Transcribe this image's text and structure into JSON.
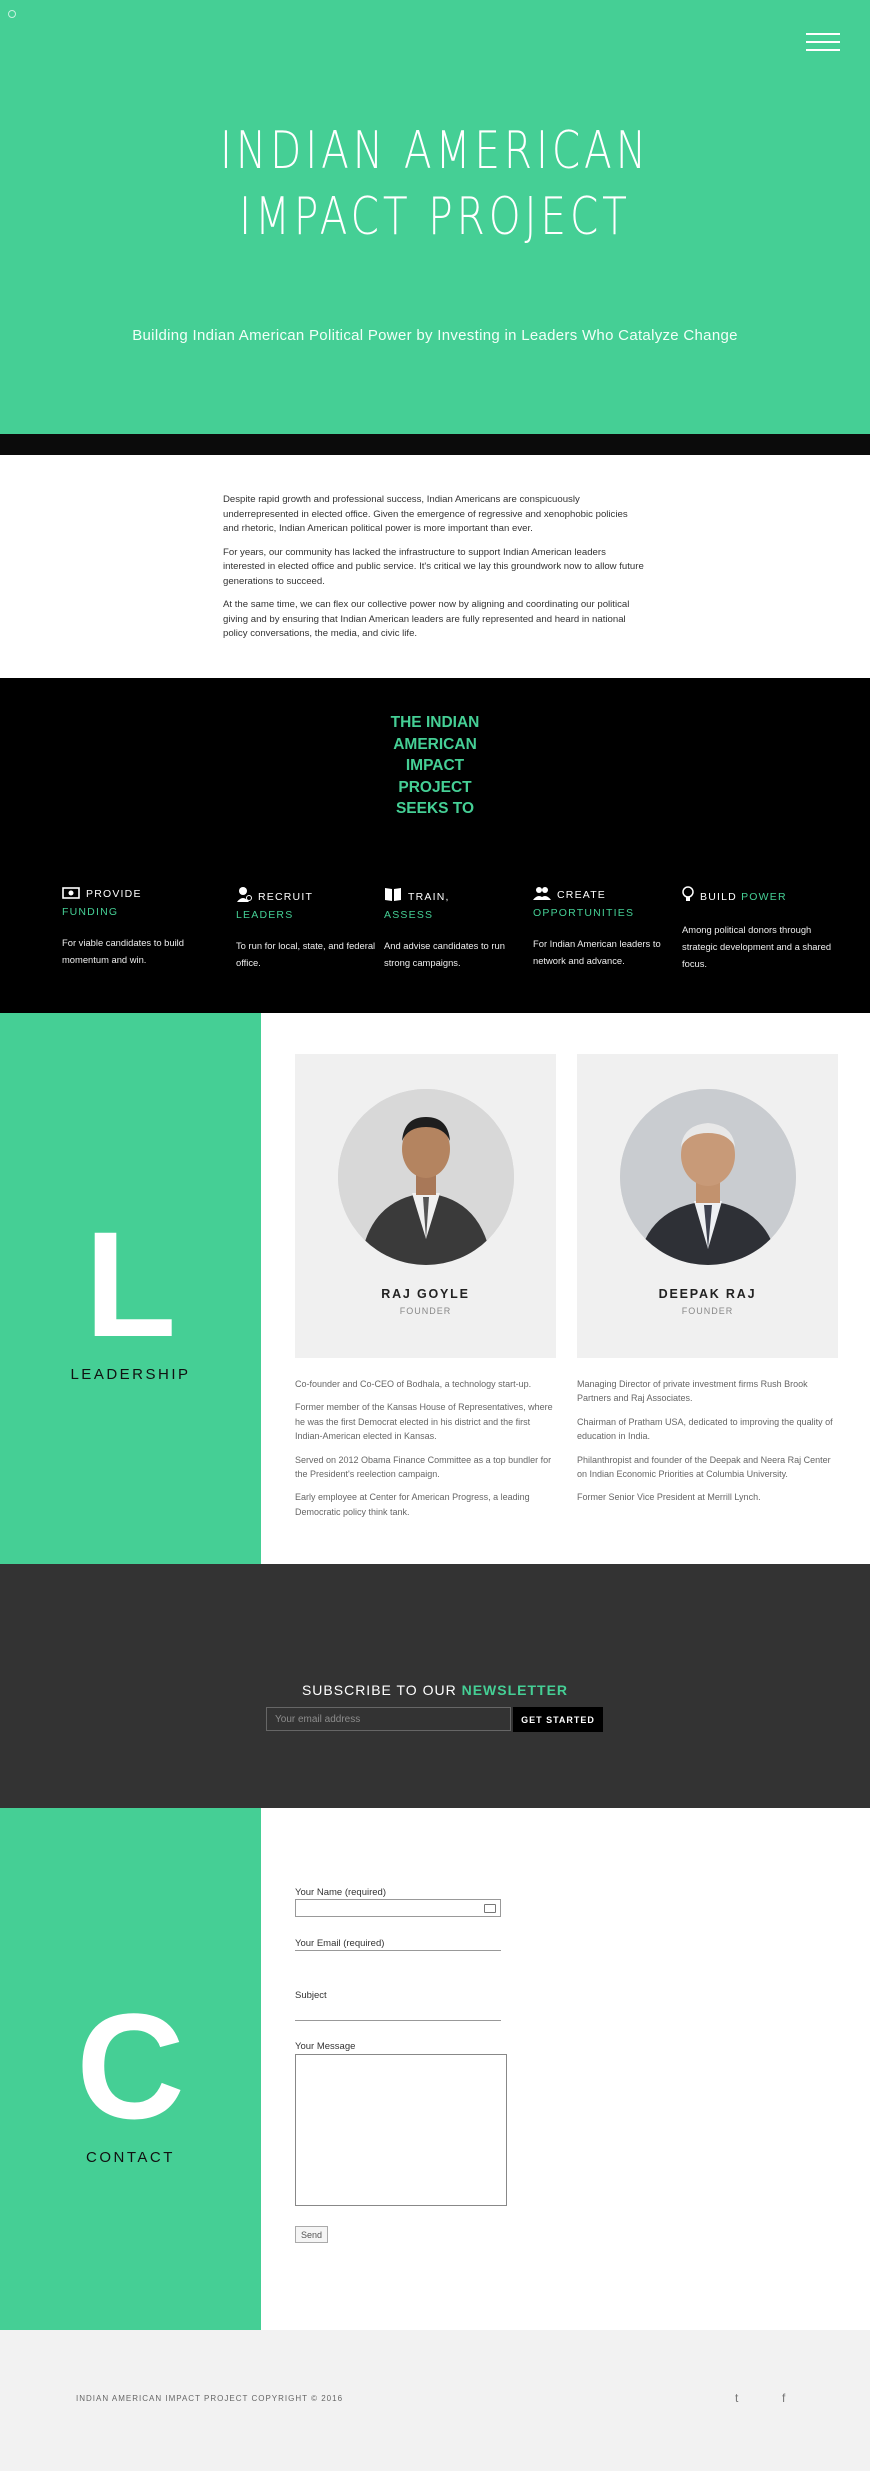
{
  "hero": {
    "title_line1": "INDIAN AMERICAN",
    "title_line2": "IMPACT PROJECT",
    "tagline": "Building Indian American Political Power by Investing in Leaders Who Catalyze Change"
  },
  "intro": {
    "paragraphs": [
      "Despite rapid growth and professional success, Indian Americans are conspicuously underrepresented in elected office. Given the emergence of regressive and xenophobic policies and rhetoric, Indian American political power is more important than ever.",
      "For years, our community has lacked the infrastructure to support Indian American leaders interested in elected office and public service. It's critical we lay this groundwork now to allow future generations to succeed.",
      "At the same time, we can flex our collective power now by aligning and coordinating our political giving and by ensuring that Indian American leaders are fully represented and heard in national policy conversations, the media, and civic life."
    ]
  },
  "seeks": {
    "title_lines": [
      "THE INDIAN",
      "AMERICAN",
      "IMPACT",
      "PROJECT",
      "SEEKS TO"
    ],
    "items": [
      {
        "icon": "money-icon",
        "word": "PROVIDE",
        "highlight": "FUNDING",
        "desc": "For viable candidates to build momentum and win."
      },
      {
        "icon": "person-icon",
        "word": "RECRUIT",
        "highlight": "LEADERS",
        "desc": "To run for local, state, and federal office."
      },
      {
        "icon": "book-icon",
        "word": "TRAIN,",
        "highlight": "ASSESS",
        "desc": "And advise candidates to run strong campaigns."
      },
      {
        "icon": "group-icon",
        "word": "CREATE",
        "highlight": "OPPORTUNITIES",
        "desc": "For Indian American leaders to network and advance."
      },
      {
        "icon": "lightbulb-icon",
        "word": "BUILD",
        "highlight": "POWER",
        "desc": "Among political donors through strategic development and a shared focus."
      }
    ]
  },
  "leadership": {
    "letter": "L",
    "label": "LEADERSHIP",
    "people": [
      {
        "name": "RAJ GOYLE",
        "role": "FOUNDER",
        "bio": [
          "Co-founder and Co-CEO of Bodhala, a technology start-up.",
          "Former member of the Kansas House of Representatives, where he was the first Democrat elected in his district and the first Indian-American elected in Kansas.",
          "Served on 2012 Obama Finance Committee as a top bundler for the President's reelection campaign.",
          "Early employee at Center for American Progress, a leading Democratic policy think tank."
        ]
      },
      {
        "name": "DEEPAK RAJ",
        "role": "FOUNDER",
        "bio": [
          "Managing Director of private investment firms Rush Brook Partners and Raj Associates.",
          "Chairman of Pratham USA, dedicated to improving the quality of education in India.",
          "Philanthropist and founder of the Deepak and Neera Raj Center on Indian Economic Priorities at Columbia University.",
          "Former Senior Vice President at Merrill Lynch."
        ]
      }
    ]
  },
  "newsletter": {
    "title_prefix": "SUBSCRIBE TO OUR",
    "title_highlight": "NEWSLETTER",
    "placeholder": "Your email address",
    "button": "GET STARTED"
  },
  "contact": {
    "letter": "C",
    "label": "CONTACT",
    "name_label": "Your Name (required)",
    "email_label": "Your Email (required)",
    "subject_label": "Subject",
    "message_label": "Your Message",
    "send": "Send"
  },
  "footer": {
    "copyright": "INDIAN AMERICAN IMPACT PROJECT COPYRIGHT © 2016",
    "twitter": "t",
    "facebook": "f"
  },
  "colors": {
    "accent": "#45cf95",
    "dark": "#333333",
    "black": "#000000"
  }
}
